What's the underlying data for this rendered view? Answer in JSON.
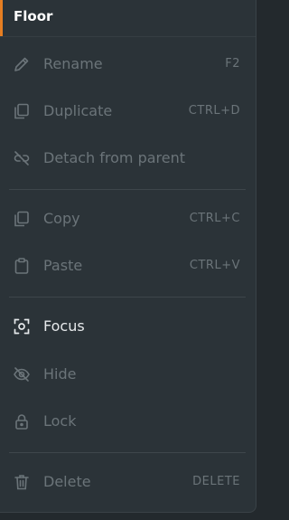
{
  "header": {
    "title": "Floor"
  },
  "colors": {
    "accent": "#e67e22",
    "disabled_text": "#6b7479",
    "enabled_text": "#e6e9eb",
    "background": "#2b3338"
  },
  "menu": {
    "rename": {
      "label": "Rename",
      "shortcut": "F2",
      "icon": "pencil-icon"
    },
    "duplicate": {
      "label": "Duplicate",
      "shortcut": "CTRL+D",
      "icon": "duplicate-icon"
    },
    "detach": {
      "label": "Detach from parent",
      "icon": "unlink-icon"
    },
    "copy": {
      "label": "Copy",
      "shortcut": "CTRL+C",
      "icon": "copy-icon"
    },
    "paste": {
      "label": "Paste",
      "shortcut": "CTRL+V",
      "icon": "clipboard-icon"
    },
    "focus": {
      "label": "Focus",
      "icon": "focus-icon"
    },
    "hide": {
      "label": "Hide",
      "icon": "eye-off-icon"
    },
    "lock": {
      "label": "Lock",
      "icon": "lock-icon"
    },
    "delete": {
      "label": "Delete",
      "shortcut": "DELETE",
      "icon": "trash-icon"
    }
  }
}
